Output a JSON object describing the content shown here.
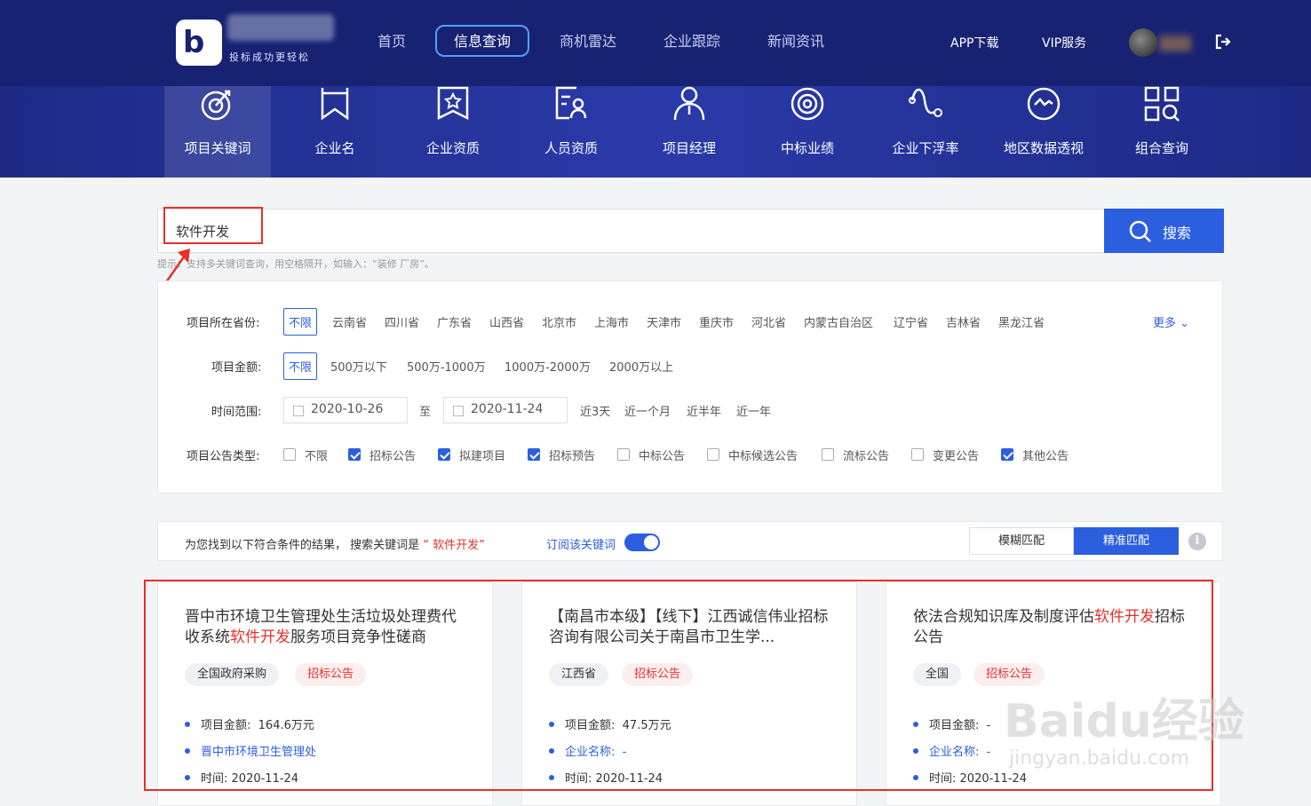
{
  "header": {
    "logo_slogan": "投标成功更轻松",
    "nav": [
      "首页",
      "信息查询",
      "商机雷达",
      "企业跟踪",
      "新闻资讯"
    ],
    "active_nav": "信息查询",
    "app_download": "APP下载",
    "vip": "VIP服务"
  },
  "iconbar": {
    "items": [
      "项目关键词",
      "企业名",
      "企业资质",
      "人员资质",
      "项目经理",
      "中标业绩",
      "企业下浮率",
      "地区数据透视",
      "组合查询"
    ],
    "active": "项目关键词"
  },
  "search": {
    "value": "软件开发",
    "button": "搜索",
    "hint": "提示：支持多关键词查询，用空格隔开，如输入：“装修 厂房”。"
  },
  "filters": {
    "province_label": "项目所在省份:",
    "provinces": [
      "不限",
      "云南省",
      "四川省",
      "广东省",
      "山西省",
      "北京市",
      "上海市",
      "天津市",
      "重庆市",
      "河北省",
      "内蒙古自治区",
      "辽宁省",
      "吉林省",
      "黑龙江省"
    ],
    "more": "更多",
    "amount_label": "项目金额:",
    "amounts": [
      "不限",
      "500万以下",
      "500万-1000万",
      "1000万-2000万",
      "2000万以上"
    ],
    "time_label": "时间范围:",
    "date_from": "2020-10-26",
    "date_sep": "至",
    "date_to": "2020-11-24",
    "quick_ranges": [
      "近3天",
      "近一个月",
      "近半年",
      "近一年"
    ],
    "type_label": "项目公告类型:",
    "types": [
      {
        "label": "不限",
        "checked": false
      },
      {
        "label": "招标公告",
        "checked": true
      },
      {
        "label": "拟建项目",
        "checked": true
      },
      {
        "label": "招标预告",
        "checked": true
      },
      {
        "label": "中标公告",
        "checked": false
      },
      {
        "label": "中标候选公告",
        "checked": false
      },
      {
        "label": "流标公告",
        "checked": false
      },
      {
        "label": "变更公告",
        "checked": false
      },
      {
        "label": "其他公告",
        "checked": true
      }
    ]
  },
  "results_bar": {
    "prefix": "为您找到以下符合条件的结果， 搜索关键词是",
    "keyword": "“ 软件开发”",
    "subscribe": "订阅该关键词",
    "subscribed": true,
    "fuzzy": "模糊匹配",
    "exact": "精准匹配"
  },
  "cards": [
    {
      "title_pre": "晋中市环境卫生管理处生活垃圾处理费代收系统",
      "title_hl": "软件开发",
      "title_post": "服务项目竞争性磋商",
      "region": "全国政府采购",
      "type": "招标公告",
      "amount_label": "项目金额:",
      "amount": "164.6万元",
      "company_label": "",
      "company": "晋中市环境卫生管理处",
      "time_label": "时间:",
      "time": "2020-11-24"
    },
    {
      "title_pre": "【南昌市本级】【线下】江西诚信伟业招标咨询有限公司关于南昌市卫生学...",
      "title_hl": "",
      "title_post": "",
      "region": "江西省",
      "type": "招标公告",
      "amount_label": "项目金额:",
      "amount": "47.5万元",
      "company_label": "企业名称:",
      "company": "-",
      "time_label": "时间:",
      "time": "2020-11-24"
    },
    {
      "title_pre": "依法合规知识库及制度评估",
      "title_hl": "软件开发",
      "title_post": "招标公告",
      "region": "全国",
      "type": "招标公告",
      "amount_label": "项目金额:",
      "amount": "-",
      "company_label": "企业名称:",
      "company": "-",
      "time_label": "时间:",
      "time": "2020-11-24"
    }
  ],
  "watermark": "Baidu经验",
  "watermark_url": "jingyan.baidu.com",
  "colors": {
    "nav_bg": "#182273",
    "accent": "#2c5ee0",
    "highlight": "#e8302a"
  }
}
